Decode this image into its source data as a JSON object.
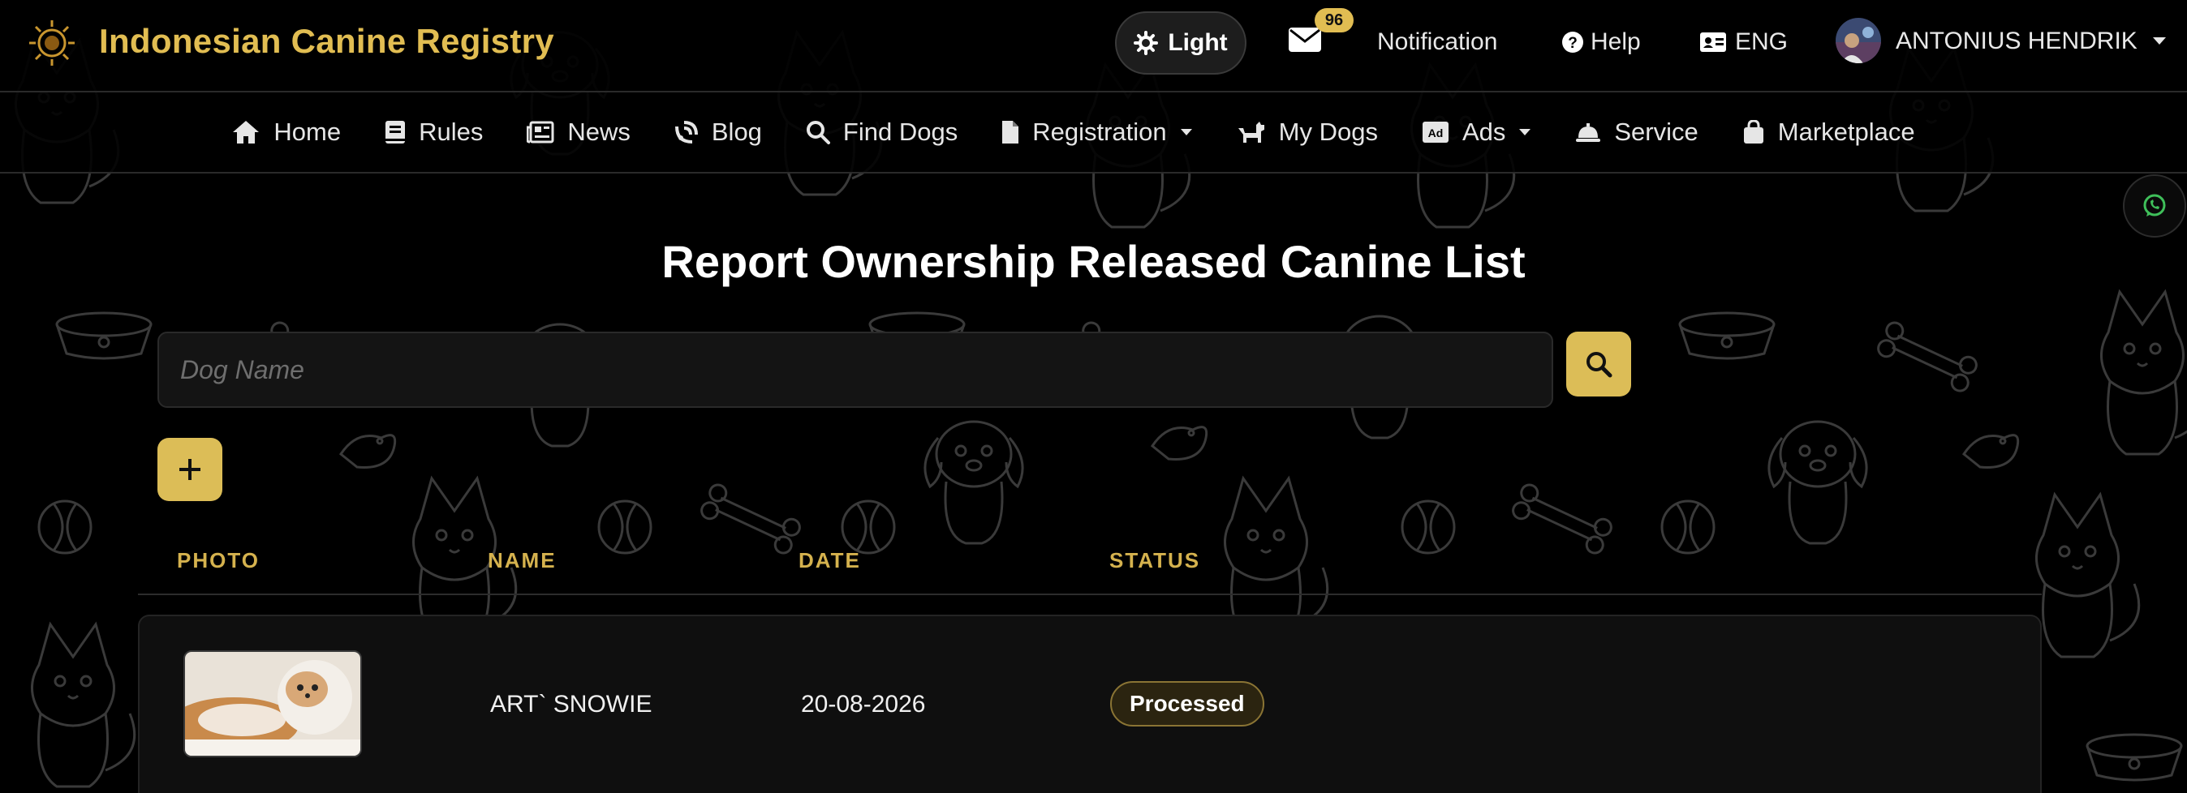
{
  "header": {
    "brand": "Indonesian Canine Registry",
    "theme_label": "Light",
    "mail_count": "96",
    "notification_label": "Notification",
    "help_label": "Help",
    "language": "ENG",
    "user_name": "ANTONIUS HENDRIK"
  },
  "nav": {
    "items": [
      {
        "label": "Home",
        "icon": "home-icon"
      },
      {
        "label": "Rules",
        "icon": "book-icon"
      },
      {
        "label": "News",
        "icon": "newspaper-icon"
      },
      {
        "label": "Blog",
        "icon": "blog-icon"
      },
      {
        "label": "Find Dogs",
        "icon": "search-icon"
      },
      {
        "label": "Registration",
        "icon": "file-icon",
        "dropdown": true
      },
      {
        "label": "My Dogs",
        "icon": "dog-icon"
      },
      {
        "label": "Ads",
        "icon": "ad-icon",
        "dropdown": true
      },
      {
        "label": "Service",
        "icon": "service-bell-icon"
      },
      {
        "label": "Marketplace",
        "icon": "shopping-bag-icon"
      }
    ]
  },
  "page": {
    "title": "Report Ownership Released Canine List",
    "search_placeholder": "Dog Name"
  },
  "table": {
    "columns": [
      "PHOTO",
      "NAME",
      "DATE",
      "STATUS"
    ],
    "rows": [
      {
        "name": "ART` SNOWIE",
        "date": "20-08-2026",
        "status": "Processed"
      }
    ]
  },
  "colors": {
    "accent": "#dcbd57",
    "background": "#000000",
    "brand_text": "#e1bd52"
  }
}
